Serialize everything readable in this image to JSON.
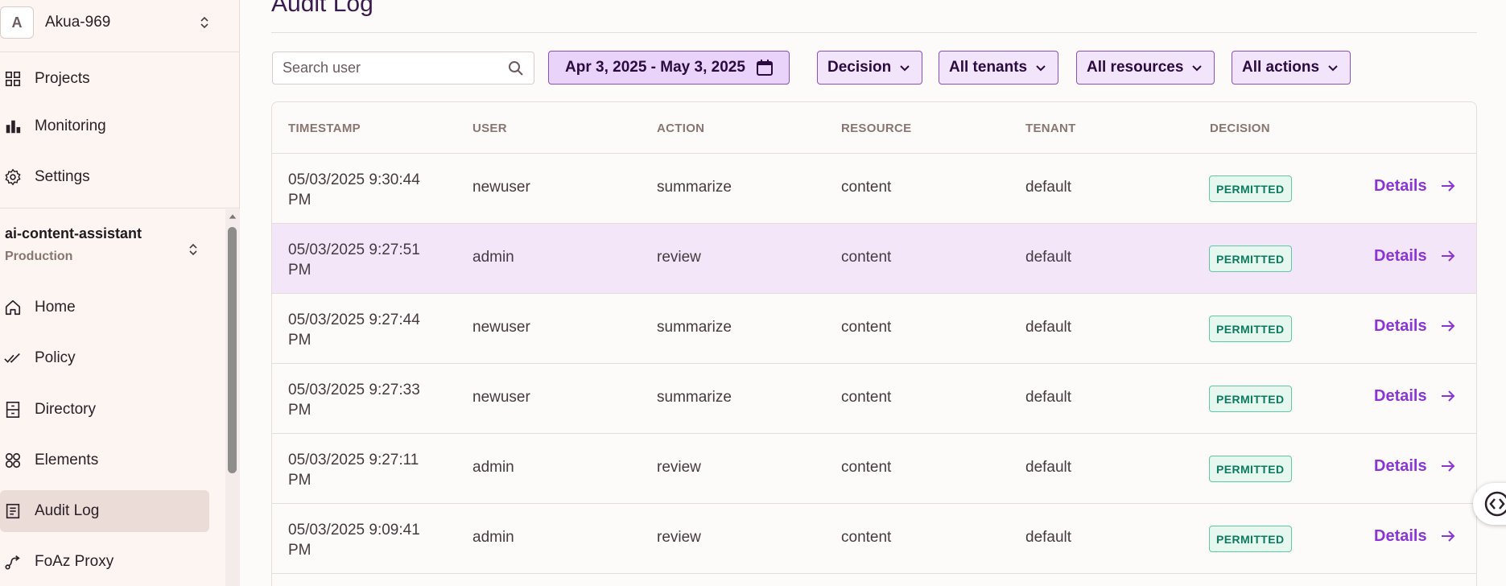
{
  "org": {
    "initial": "A",
    "name": "Akua-969"
  },
  "top_nav": [
    {
      "label": "Projects",
      "icon": "grid-icon"
    },
    {
      "label": "Monitoring",
      "icon": "bar-chart-icon"
    },
    {
      "label": "Settings",
      "icon": "gear-icon"
    }
  ],
  "project": {
    "name": "ai-content-assistant",
    "environment": "Production"
  },
  "project_nav": [
    {
      "label": "Home",
      "icon": "home-icon"
    },
    {
      "label": "Policy",
      "icon": "double-check-icon"
    },
    {
      "label": "Directory",
      "icon": "cabinet-icon"
    },
    {
      "label": "Elements",
      "icon": "elements-icon"
    },
    {
      "label": "Audit Log",
      "icon": "document-icon",
      "active": true
    },
    {
      "label": "FoAz Proxy",
      "icon": "proxy-icon"
    }
  ],
  "page": {
    "title": "Audit Log"
  },
  "filters": {
    "search_placeholder": "Search user",
    "date_range": "Apr 3, 2025 - May 3, 2025",
    "decision": "Decision",
    "tenants": "All tenants",
    "resources": "All resources",
    "actions": "All actions"
  },
  "table": {
    "headers": [
      "TIMESTAMP",
      "USER",
      "ACTION",
      "RESOURCE",
      "TENANT",
      "DECISION"
    ],
    "details_label": "Details",
    "rows": [
      {
        "ts1": "05/03/2025 9:30:44",
        "ts2": "PM",
        "user": "newuser",
        "action": "summarize",
        "resource": "content",
        "tenant": "default",
        "decision": "PERMITTED"
      },
      {
        "ts1": "05/03/2025 9:27:51",
        "ts2": "PM",
        "user": "admin",
        "action": "review",
        "resource": "content",
        "tenant": "default",
        "decision": "PERMITTED"
      },
      {
        "ts1": "05/03/2025 9:27:44",
        "ts2": "PM",
        "user": "newuser",
        "action": "summarize",
        "resource": "content",
        "tenant": "default",
        "decision": "PERMITTED"
      },
      {
        "ts1": "05/03/2025 9:27:33",
        "ts2": "PM",
        "user": "newuser",
        "action": "summarize",
        "resource": "content",
        "tenant": "default",
        "decision": "PERMITTED"
      },
      {
        "ts1": "05/03/2025 9:27:11",
        "ts2": "PM",
        "user": "admin",
        "action": "review",
        "resource": "content",
        "tenant": "default",
        "decision": "PERMITTED"
      },
      {
        "ts1": "05/03/2025 9:09:41",
        "ts2": "PM",
        "user": "admin",
        "action": "review",
        "resource": "content",
        "tenant": "default",
        "decision": "PERMITTED"
      }
    ]
  },
  "colors": {
    "accent": "#8b35d6",
    "permitted_bg": "#e6f7ef",
    "permitted_text": "#0c7a5e",
    "highlight_row": "#f3e6f9"
  }
}
